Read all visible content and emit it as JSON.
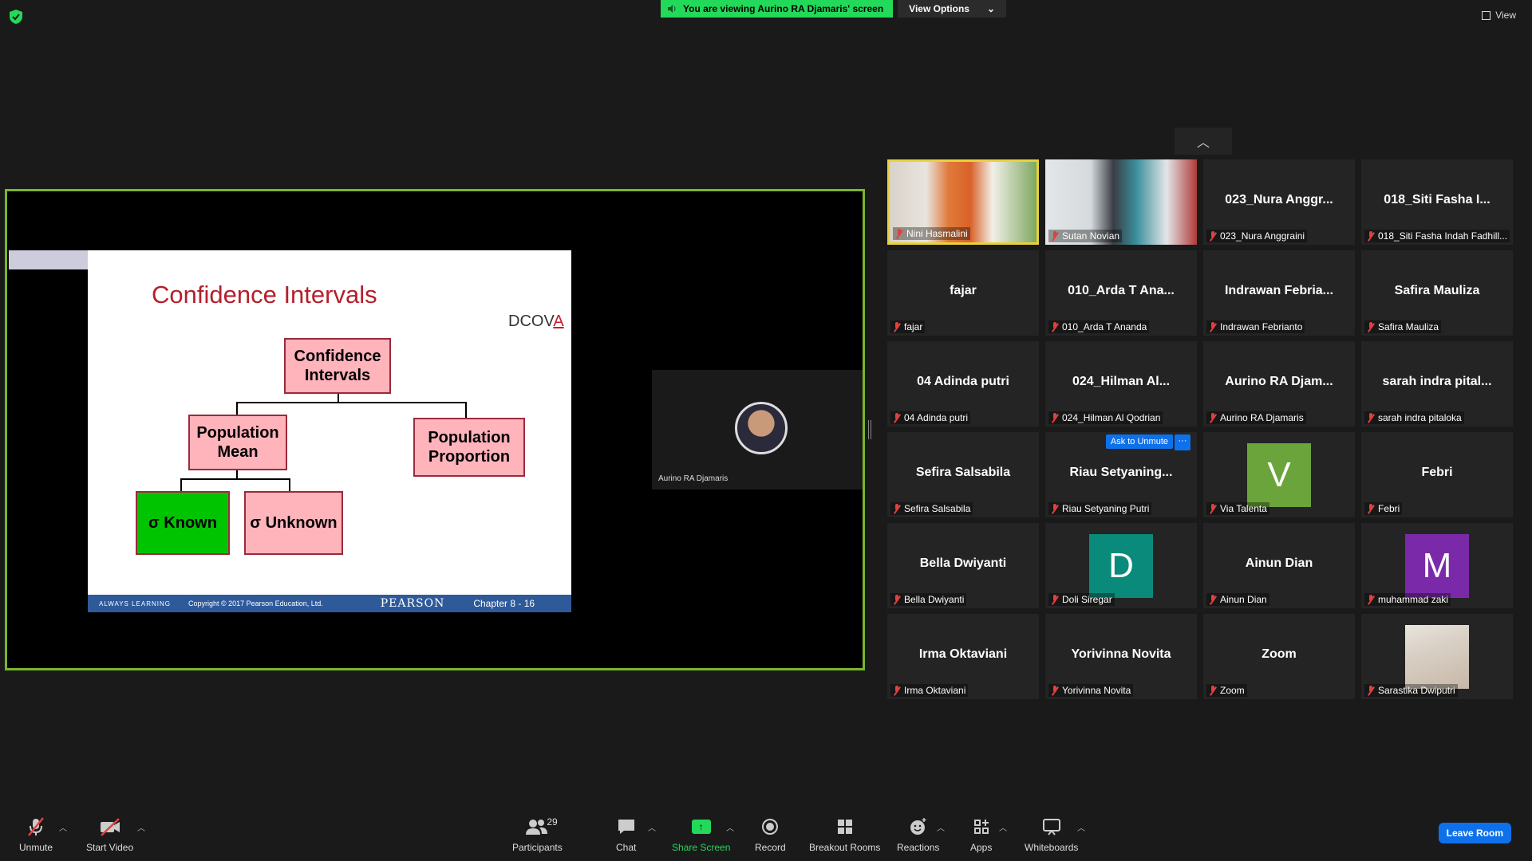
{
  "banner": {
    "viewing_text": "You are viewing Aurino RA Djamaris' screen",
    "view_options": "View Options"
  },
  "top_right": {
    "view_label": "View"
  },
  "slide": {
    "title": "Confidence Intervals",
    "brand": "DCOV",
    "brand_accent": "A",
    "box_root": "Confidence Intervals",
    "box_mean": "Population Mean",
    "box_proportion": "Population Proportion",
    "box_known": "σ Known",
    "box_unknown": "σ Unknown",
    "footer_always": "ALWAYS LEARNING",
    "footer_copyright": "Copyright © 2017 Pearson Education, Ltd.",
    "footer_pearson": "PEARSON",
    "footer_chapter": "Chapter 8 - 16"
  },
  "presenter": {
    "name": "Aurino RA Djamaris"
  },
  "tiles": [
    {
      "big": "",
      "label": "Nini Hasmalini"
    },
    {
      "big": "",
      "label": "Sutan Novian"
    },
    {
      "big": "023_Nura  Anggr...",
      "label": "023_Nura Anggraini"
    },
    {
      "big": "018_Siti Fasha I...",
      "label": "018_Siti Fasha Indah Fadhill..."
    },
    {
      "big": "fajar",
      "label": "fajar"
    },
    {
      "big": "010_Arda T Ana...",
      "label": "010_Arda T Ananda"
    },
    {
      "big": "Indrawan  Febria...",
      "label": "Indrawan Febrianto"
    },
    {
      "big": "Safira Mauliza",
      "label": "Safira Mauliza"
    },
    {
      "big": "04 Adinda putri",
      "label": "04 Adinda putri"
    },
    {
      "big": "024_Hilman  Al...",
      "label": "024_Hilman Al Qodrian"
    },
    {
      "big": "Aurino RA  Djam...",
      "label": "Aurino RA Djamaris"
    },
    {
      "big": "sarah indra pital...",
      "label": "sarah indra pitaloka"
    },
    {
      "big": "Sefira Salsabila",
      "label": "Sefira Salsabila"
    },
    {
      "big": "Riau  Setyaning...",
      "label": "Riau Setyaning Putri"
    },
    {
      "big": "",
      "label": "Via Talenta",
      "avatar": "V"
    },
    {
      "big": "Febri",
      "label": "Febri"
    },
    {
      "big": "Bella Dwiyanti",
      "label": "Bella Dwiyanti"
    },
    {
      "big": "",
      "label": "Doli Siregar",
      "avatar": "D"
    },
    {
      "big": "Ainun Dian",
      "label": "Ainun Dian"
    },
    {
      "big": "",
      "label": "muhammad zaki",
      "avatar": "M"
    },
    {
      "big": "Irma Oktaviani",
      "label": "Irma Oktaviani"
    },
    {
      "big": "Yorivinna Novita",
      "label": "Yorivinna Novita"
    },
    {
      "big": "Zoom",
      "label": "Zoom"
    },
    {
      "big": "",
      "label": "Sarastika Dwiputri"
    }
  ],
  "ask_unmute": "Ask to Unmute",
  "more": "···",
  "colors": {
    "avatar_v": "#6aa43a",
    "avatar_d": "#0a8a7a",
    "avatar_m": "#7a2aa8",
    "accent_share": "#7ab52c",
    "leave": "#0e71eb"
  },
  "toolbar": {
    "unmute": "Unmute",
    "start_video": "Start Video",
    "participants": "Participants",
    "participants_count": "29",
    "chat": "Chat",
    "share_screen": "Share Screen",
    "record": "Record",
    "breakout_rooms": "Breakout Rooms",
    "reactions": "Reactions",
    "apps": "Apps",
    "whiteboards": "Whiteboards",
    "leave": "Leave Room"
  }
}
